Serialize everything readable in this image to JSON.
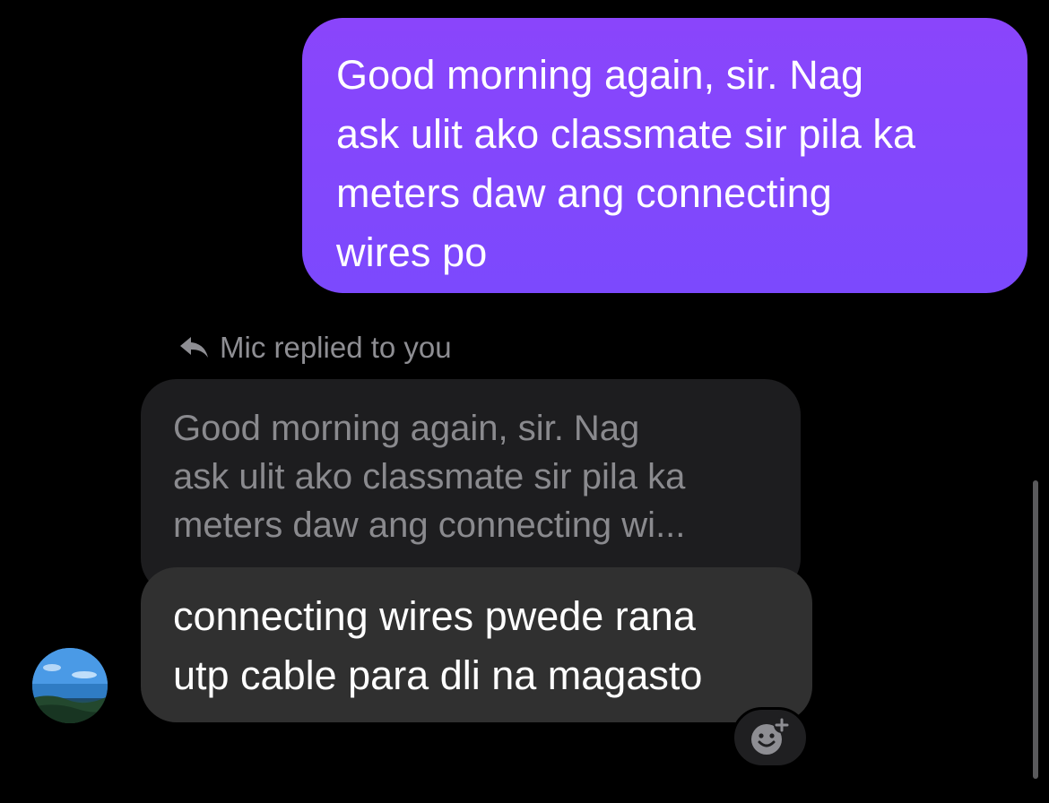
{
  "outgoing_message": {
    "lines": "Good morning again, sir. Nag\nask ulit ako classmate sir pila ka\nmeters daw ang connecting\nwires po",
    "color": "#8a45fb"
  },
  "reply_context": {
    "label": "Mic replied to you",
    "icon": "reply-arrow-icon"
  },
  "quoted_message": {
    "lines": "Good morning again, sir. Nag\nask ulit ako classmate sir pila ka\nmeters daw ang connecting wi..."
  },
  "incoming_message": {
    "lines": "connecting wires pwede rana\nutp cable para dli na magasto",
    "color": "#303030"
  },
  "avatar": {
    "icon": "contact-avatar"
  },
  "reaction": {
    "icon": "add-reaction-icon"
  }
}
